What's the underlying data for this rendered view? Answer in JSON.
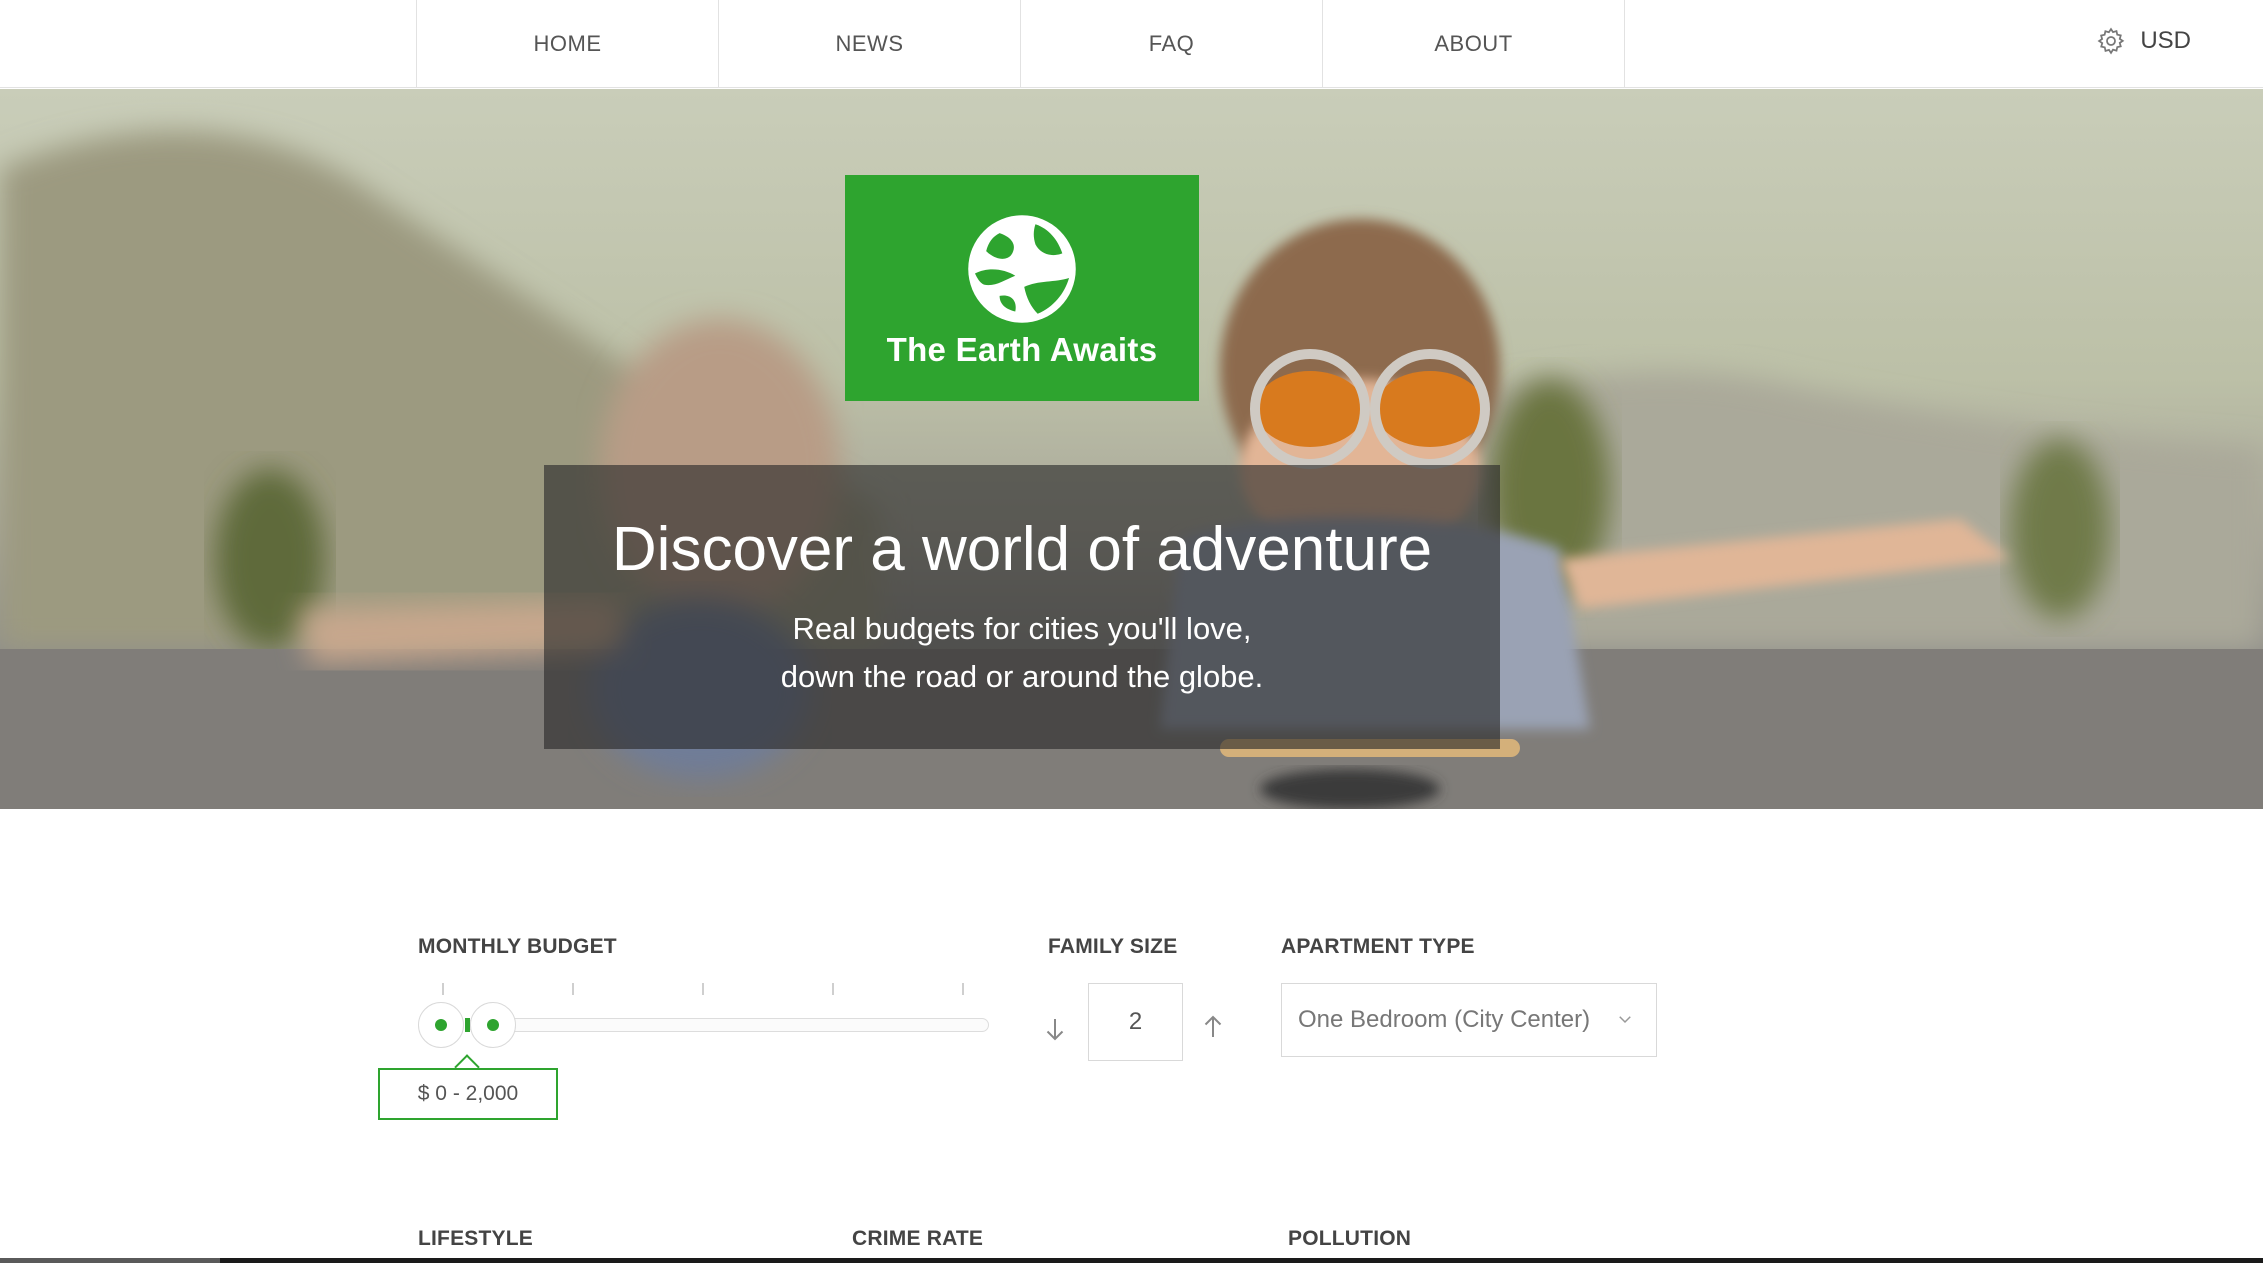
{
  "nav": {
    "items": [
      "HOME",
      "NEWS",
      "FAQ",
      "ABOUT"
    ],
    "currency": "USD",
    "currency_icon": "gear-icon"
  },
  "hero": {
    "logo_text": "The Earth Awaits",
    "logo_icon": "globe-hands-icon",
    "title": "Discover a world of adventure",
    "subtitle_line1": "Real budgets for cities you'll love,",
    "subtitle_line2": "down the road or around the globe."
  },
  "filters": {
    "monthly_budget": {
      "label": "MONTHLY BUDGET",
      "range_text": "$ 0 - 2,000",
      "min": 0,
      "max": 2000
    },
    "family_size": {
      "label": "FAMILY SIZE",
      "value": "2"
    },
    "apartment_type": {
      "label": "APARTMENT TYPE",
      "value": "One Bedroom (City Center)"
    },
    "lifestyle_label": "LIFESTYLE",
    "crime_rate_label": "CRIME RATE",
    "pollution_label": "POLLUTION"
  },
  "colors": {
    "accent": "#2ea42f",
    "overlay": "#282828"
  }
}
